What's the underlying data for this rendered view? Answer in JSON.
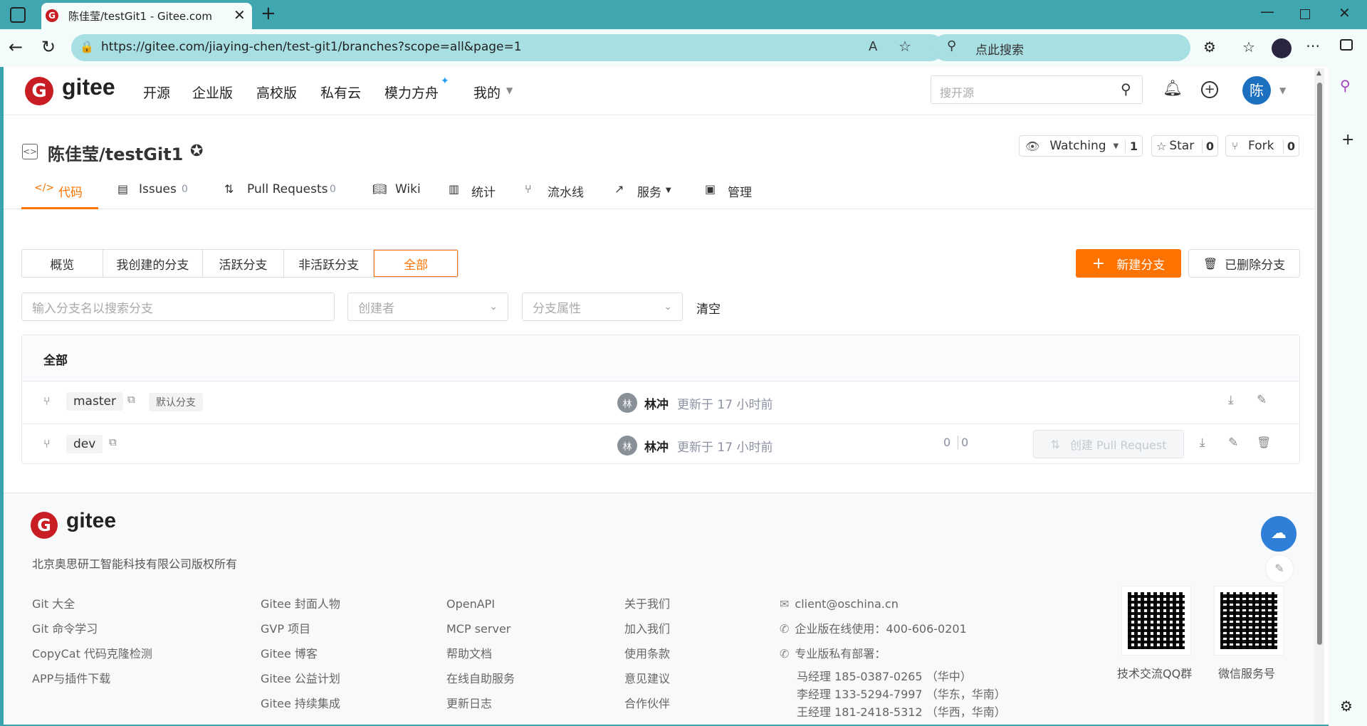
{
  "browser": {
    "tab_title": "陈佳莹/testGit1 - Gitee.com",
    "url": "https://gitee.com/jiaying-chen/test-git1/branches?scope=all&page=1",
    "search_placeholder": "点此搜索"
  },
  "header": {
    "logo_text": "gitee",
    "nav": [
      "开源",
      "企业版",
      "高校版",
      "私有云",
      "模力方舟",
      "我的"
    ],
    "search_placeholder": "搜开源",
    "avatar_text": "陈"
  },
  "repo": {
    "title": "陈佳莹/testGit1",
    "watch_label": "Watching",
    "watch_count": "1",
    "star_label": "Star",
    "star_count": "0",
    "fork_label": "Fork",
    "fork_count": "0",
    "tabs": [
      {
        "label": "代码",
        "count": ""
      },
      {
        "label": "Issues",
        "count": "0"
      },
      {
        "label": "Pull Requests",
        "count": "0"
      },
      {
        "label": "Wiki",
        "count": ""
      },
      {
        "label": "统计",
        "count": ""
      },
      {
        "label": "流水线",
        "count": ""
      },
      {
        "label": "服务",
        "count": ""
      },
      {
        "label": "管理",
        "count": ""
      }
    ]
  },
  "branches": {
    "filters": [
      "概览",
      "我创建的分支",
      "活跃分支",
      "非活跃分支",
      "全部"
    ],
    "new_branch": "新建分支",
    "deleted_branches": "已删除分支",
    "search_placeholder": "输入分支名以搜索分支",
    "creator_placeholder": "创建者",
    "attr_placeholder": "分支属性",
    "clear": "清空",
    "list_title": "全部",
    "rows": [
      {
        "name": "master",
        "badge": "默认分支",
        "avatar": "林",
        "author": "林冲",
        "updated": "更新于 17 小时前",
        "behind": "",
        "ahead": "",
        "pr": ""
      },
      {
        "name": "dev",
        "badge": "",
        "avatar": "林",
        "author": "林冲",
        "updated": "更新于 17 小时前",
        "behind": "0",
        "ahead": "0",
        "pr": "创建 Pull Request"
      }
    ]
  },
  "footer": {
    "logo_text": "gitee",
    "copyright": "北京奥思研工智能科技有限公司版权所有",
    "col1": [
      "Git 大全",
      "Git 命令学习",
      "CopyCat 代码克隆检测",
      "APP与插件下载"
    ],
    "col2": [
      "Gitee 封面人物",
      "GVP 项目",
      "Gitee 博客",
      "Gitee 公益计划",
      "Gitee 持续集成"
    ],
    "col3": [
      "OpenAPI",
      "MCP server",
      "帮助文档",
      "在线自助服务",
      "更新日志"
    ],
    "col4": [
      "关于我们",
      "加入我们",
      "使用条款",
      "意见建议",
      "合作伙伴"
    ],
    "email": "client@oschina.cn",
    "enterprise": "企业版在线使用：400-606-0201",
    "private_label": "专业版私有部署：",
    "contacts": [
      "马经理 185-0387-0265 （华中）",
      "李经理 133-5294-7997 （华东，华南）",
      "王经理 181-2418-5312 （华西，华南）"
    ],
    "qr1_label": "技术交流QQ群",
    "qr2_label": "微信服务号"
  },
  "colors": {
    "accent": "#fe7300",
    "brand_red": "#c71d23",
    "browser_teal": "#40a6b0"
  }
}
